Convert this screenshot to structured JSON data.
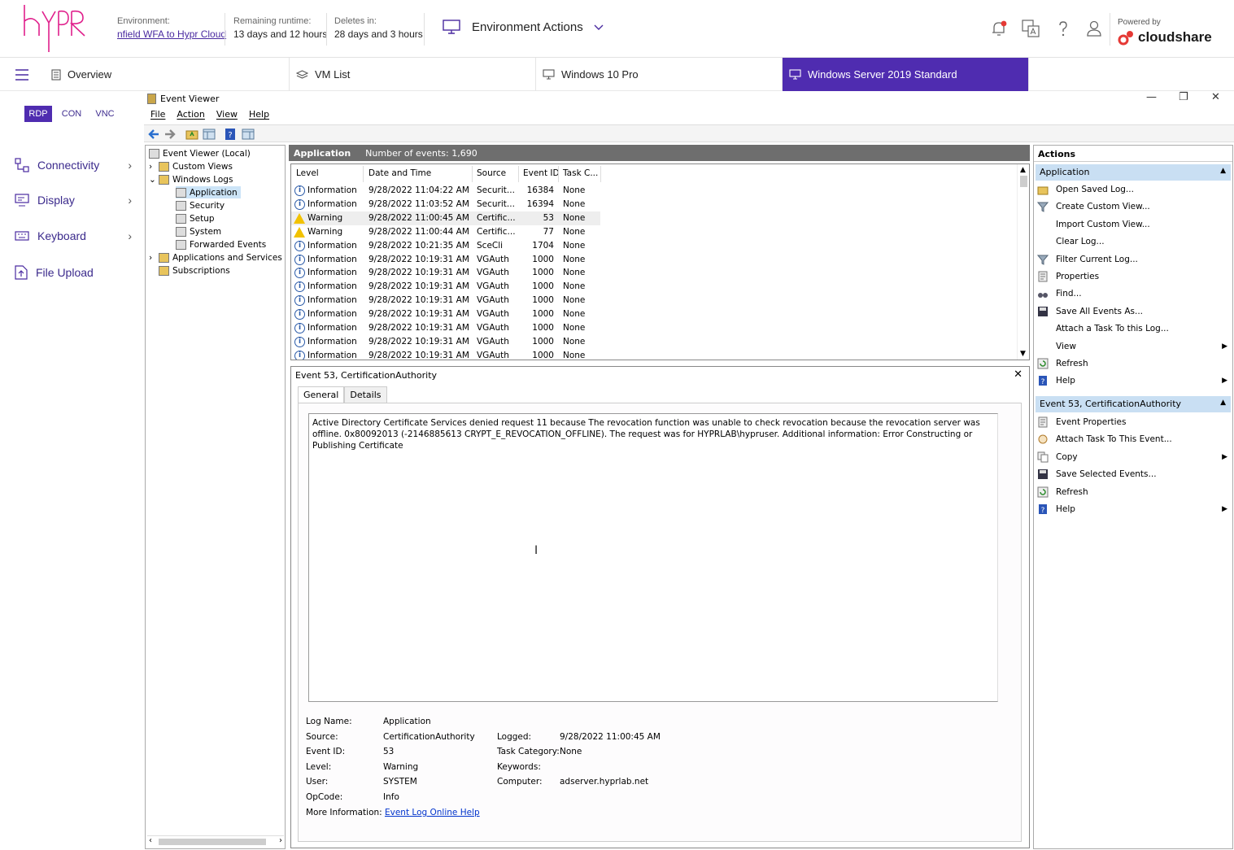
{
  "topbar": {
    "environment_label": "Environment:",
    "environment_value": "nfield WFA to Hypr Cloud",
    "runtime_label": "Remaining runtime:",
    "runtime_value": "13 days and 12 hours",
    "deletes_label": "Deletes in:",
    "deletes_value": "28 days and 3 hours",
    "env_actions_label": "Environment Actions",
    "powered_by": "Powered by",
    "brand": "cloudshare",
    "logo_text": "HYPR",
    "brand_color": "#e0208c",
    "accent_color": "#4f2cb0"
  },
  "tabs": [
    {
      "label": "Overview",
      "icon": "document-icon"
    },
    {
      "label": "VM List",
      "icon": "layers-icon"
    },
    {
      "label": "Windows 10 Pro",
      "icon": "monitor-icon"
    },
    {
      "label": "Windows Server 2019 Standard",
      "icon": "monitor-icon",
      "active": true
    }
  ],
  "sidebar": {
    "protocols": [
      "RDP",
      "CON",
      "VNC"
    ],
    "selected_protocol": "RDP",
    "items": [
      {
        "label": "Connectivity",
        "icon": "connectivity-icon"
      },
      {
        "label": "Display",
        "icon": "display-icon"
      },
      {
        "label": "Keyboard",
        "icon": "keyboard-icon"
      },
      {
        "label": "File Upload",
        "icon": "file-upload-icon"
      }
    ]
  },
  "eventviewer": {
    "title": "Event Viewer",
    "menu": [
      "File",
      "Action",
      "View",
      "Help"
    ],
    "tree": [
      {
        "label": "Event Viewer (Local)"
      },
      {
        "label": "Custom Views"
      },
      {
        "label": "Windows Logs"
      },
      {
        "label": "Application"
      },
      {
        "label": "Security"
      },
      {
        "label": "Setup"
      },
      {
        "label": "System"
      },
      {
        "label": "Forwarded Events"
      },
      {
        "label": "Applications and Services Lo"
      },
      {
        "label": "Subscriptions"
      }
    ],
    "grid_title": "Application",
    "grid_count": "Number of events: 1,690",
    "columns": [
      "Level",
      "Date and Time",
      "Source",
      "Event ID",
      "Task C..."
    ],
    "rows": [
      {
        "level": "Information",
        "date": "9/28/2022 11:04:22 AM",
        "source": "Securit...",
        "id": "16384",
        "task": "None",
        "type": "info"
      },
      {
        "level": "Information",
        "date": "9/28/2022 11:03:52 AM",
        "source": "Securit...",
        "id": "16394",
        "task": "None",
        "type": "info"
      },
      {
        "level": "Warning",
        "date": "9/28/2022 11:00:45 AM",
        "source": "Certific...",
        "id": "53",
        "task": "None",
        "type": "warn"
      },
      {
        "level": "Warning",
        "date": "9/28/2022 11:00:44 AM",
        "source": "Certific...",
        "id": "77",
        "task": "None",
        "type": "warn"
      },
      {
        "level": "Information",
        "date": "9/28/2022 10:21:35 AM",
        "source": "SceCli",
        "id": "1704",
        "task": "None",
        "type": "info"
      },
      {
        "level": "Information",
        "date": "9/28/2022 10:19:31 AM",
        "source": "VGAuth",
        "id": "1000",
        "task": "None",
        "type": "info"
      },
      {
        "level": "Information",
        "date": "9/28/2022 10:19:31 AM",
        "source": "VGAuth",
        "id": "1000",
        "task": "None",
        "type": "info"
      },
      {
        "level": "Information",
        "date": "9/28/2022 10:19:31 AM",
        "source": "VGAuth",
        "id": "1000",
        "task": "None",
        "type": "info"
      },
      {
        "level": "Information",
        "date": "9/28/2022 10:19:31 AM",
        "source": "VGAuth",
        "id": "1000",
        "task": "None",
        "type": "info"
      },
      {
        "level": "Information",
        "date": "9/28/2022 10:19:31 AM",
        "source": "VGAuth",
        "id": "1000",
        "task": "None",
        "type": "info"
      },
      {
        "level": "Information",
        "date": "9/28/2022 10:19:31 AM",
        "source": "VGAuth",
        "id": "1000",
        "task": "None",
        "type": "info"
      },
      {
        "level": "Information",
        "date": "9/28/2022 10:19:31 AM",
        "source": "VGAuth",
        "id": "1000",
        "task": "None",
        "type": "info"
      },
      {
        "level": "Information",
        "date": "9/28/2022 10:19:31 AM",
        "source": "VGAuth",
        "id": "1000",
        "task": "None",
        "type": "info"
      }
    ],
    "detail": {
      "title": "Event 53, CertificationAuthority",
      "tabs": [
        "General",
        "Details"
      ],
      "message": "Active Directory Certificate Services denied request 11 because The revocation function was unable to check revocation because the revocation server was offline. 0x80092013 (-2146885613 CRYPT_E_REVOCATION_OFFLINE).  The request was for HYPRLAB\\hypruser.  Additional information: Error Constructing or Publishing Certificate",
      "log_name_label": "Log Name:",
      "log_name": "Application",
      "source_label": "Source:",
      "source": "CertificationAuthority",
      "logged_label": "Logged:",
      "logged": "9/28/2022 11:00:45 AM",
      "event_id_label": "Event ID:",
      "event_id": "53",
      "task_cat_label": "Task Category:",
      "task_cat": "None",
      "level_label": "Level:",
      "level": "Warning",
      "keywords_label": "Keywords:",
      "user_label": "User:",
      "user": "SYSTEM",
      "computer_label": "Computer:",
      "computer": "adserver.hyprlab.net",
      "opcode_label": "OpCode:",
      "opcode": "Info",
      "more_label": "More Information:",
      "more_link": "Event Log Online Help"
    },
    "actions": {
      "header": "Actions",
      "section1": "Application",
      "section1_items": [
        {
          "label": "Open Saved Log...",
          "icon": "folder-open-icon"
        },
        {
          "label": "Create Custom View...",
          "icon": "filter-icon"
        },
        {
          "label": "Import Custom View...",
          "icon": ""
        },
        {
          "label": "Clear Log...",
          "icon": ""
        },
        {
          "label": "Filter Current Log...",
          "icon": "filter-icon"
        },
        {
          "label": "Properties",
          "icon": "properties-icon"
        },
        {
          "label": "Find...",
          "icon": "binoculars-icon"
        },
        {
          "label": "Save All Events As...",
          "icon": "save-icon"
        },
        {
          "label": "Attach a Task To this Log...",
          "icon": ""
        },
        {
          "label": "View",
          "icon": "",
          "submenu": true
        },
        {
          "label": "Refresh",
          "icon": "refresh-icon"
        },
        {
          "label": "Help",
          "icon": "help-icon",
          "submenu": true
        }
      ],
      "section2": "Event 53, CertificationAuthority",
      "section2_items": [
        {
          "label": "Event Properties",
          "icon": "properties-icon"
        },
        {
          "label": "Attach Task To This Event...",
          "icon": "task-icon"
        },
        {
          "label": "Copy",
          "icon": "copy-icon",
          "submenu": true
        },
        {
          "label": "Save Selected Events...",
          "icon": "save-icon"
        },
        {
          "label": "Refresh",
          "icon": "refresh-icon"
        },
        {
          "label": "Help",
          "icon": "help-icon",
          "submenu": true
        }
      ]
    }
  }
}
